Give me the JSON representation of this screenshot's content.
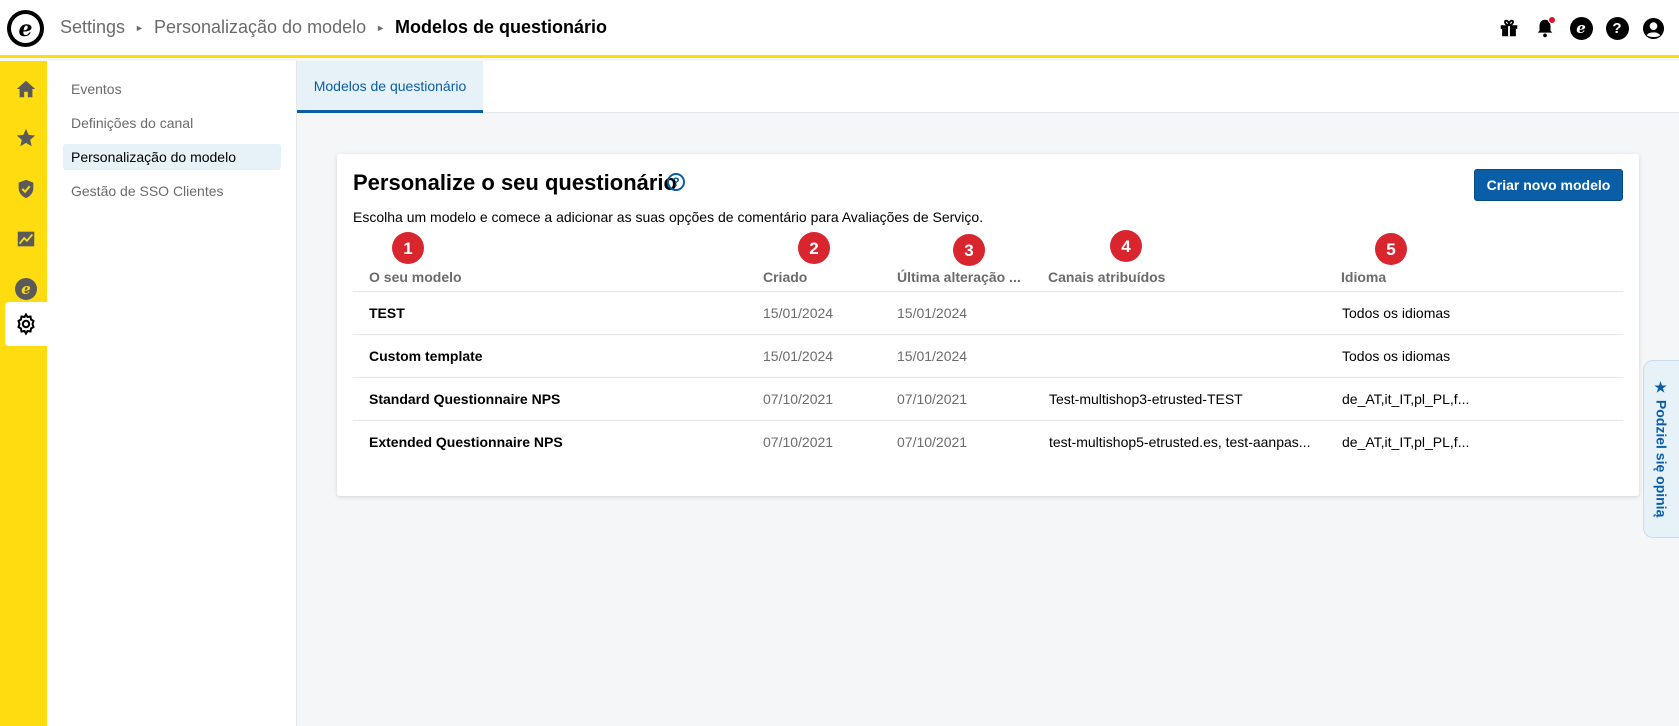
{
  "header": {
    "breadcrumb": [
      "Settings",
      "Personalização do modelo"
    ],
    "current_page": "Modelos de questionário",
    "logo_letter": "e",
    "icons": [
      "gift-icon",
      "bell-icon",
      "etrusted-icon",
      "help-icon",
      "user-icon"
    ]
  },
  "rail": {
    "items": [
      "home-icon",
      "star-icon",
      "shield-icon",
      "analytics-icon",
      "etrusted-icon",
      "gear-icon"
    ],
    "active": "gear-icon"
  },
  "subnav": {
    "items": [
      {
        "label": "Eventos"
      },
      {
        "label": "Definições do canal"
      },
      {
        "label": "Personalização do modelo"
      },
      {
        "label": "Gestão de SSO Clientes"
      }
    ],
    "active_index": 2
  },
  "tabs": [
    {
      "label": "Modelos de questionário"
    }
  ],
  "card": {
    "title": "Personalize o seu questionário",
    "help_icon_text": "?",
    "description": "Escolha um modelo e comece a adicionar as suas opções de comentário para Avaliações de Serviço.",
    "create_button": "Criar novo modelo"
  },
  "annotations": [
    "1",
    "2",
    "3",
    "4",
    "5"
  ],
  "table": {
    "headers": [
      "O seu modelo",
      "Criado",
      "Última alteração ...",
      "Canais atribuídos",
      "Idioma"
    ],
    "rows": [
      {
        "name": "TEST",
        "created": "15/01/2024",
        "modified": "15/01/2024",
        "channels": "",
        "language": "Todos os idiomas"
      },
      {
        "name": "Custom template",
        "created": "15/01/2024",
        "modified": "15/01/2024",
        "channels": "",
        "language": "Todos os idiomas"
      },
      {
        "name": "Standard Questionnaire NPS",
        "created": "07/10/2021",
        "modified": "07/10/2021",
        "channels": "Test-multishop3-etrusted-TEST",
        "language": "de_AT,it_IT,pl_PL,f..."
      },
      {
        "name": "Extended Questionnaire NPS",
        "created": "07/10/2021",
        "modified": "07/10/2021",
        "channels": "test-multishop5-etrusted.es, test-aanpas...",
        "language": "de_AT,it_IT,pl_PL,f..."
      }
    ]
  },
  "feedback_tab": {
    "label": "★ Podziel się opinią"
  },
  "colors": {
    "accent_yellow": "#ffdc0f",
    "primary_blue": "#0a5ea8",
    "badge_red": "#d9262e"
  }
}
